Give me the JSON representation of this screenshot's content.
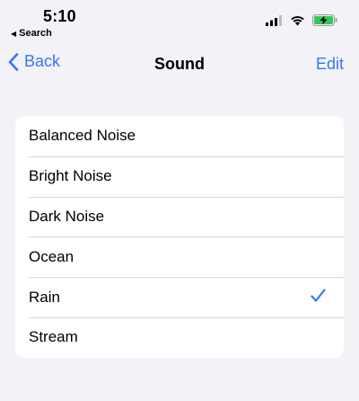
{
  "status_bar": {
    "time": "5:10",
    "back_app_label": "Search",
    "icons": [
      "cellular-signal-icon",
      "wifi-icon",
      "battery-charging-icon"
    ]
  },
  "nav": {
    "back_label": "Back",
    "title": "Sound",
    "edit_label": "Edit"
  },
  "sounds": [
    {
      "label": "Balanced Noise",
      "selected": false
    },
    {
      "label": "Bright Noise",
      "selected": false
    },
    {
      "label": "Dark Noise",
      "selected": false
    },
    {
      "label": "Ocean",
      "selected": false
    },
    {
      "label": "Rain",
      "selected": true
    },
    {
      "label": "Stream",
      "selected": false
    }
  ],
  "colors": {
    "accent": "#3478f6",
    "background": "#f2f2f7",
    "battery": "#34c759"
  }
}
